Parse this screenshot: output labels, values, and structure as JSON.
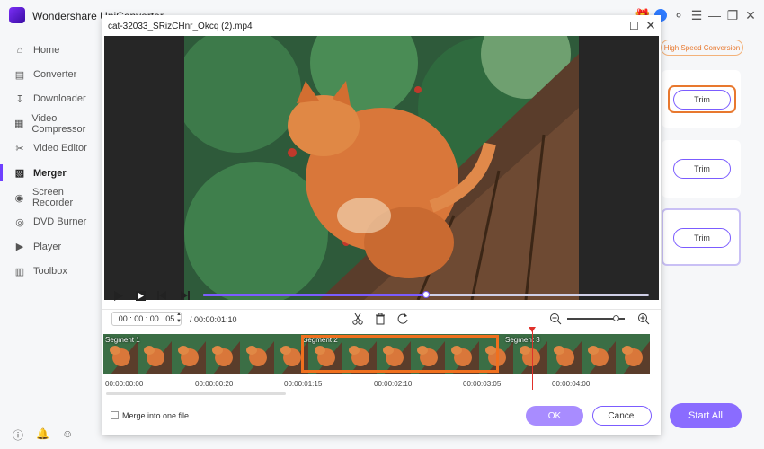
{
  "app": {
    "title": "Wondershare UniConverter"
  },
  "sidebar": {
    "items": [
      {
        "label": "Home",
        "icon": "home-icon"
      },
      {
        "label": "Converter",
        "icon": "converter-icon"
      },
      {
        "label": "Downloader",
        "icon": "downloader-icon"
      },
      {
        "label": "Video Compressor",
        "icon": "compressor-icon"
      },
      {
        "label": "Video Editor",
        "icon": "scissors-icon"
      },
      {
        "label": "Merger",
        "icon": "merger-icon",
        "active": true
      },
      {
        "label": "Screen Recorder",
        "icon": "recorder-icon"
      },
      {
        "label": "DVD Burner",
        "icon": "dvd-icon"
      },
      {
        "label": "Player",
        "icon": "player-icon"
      },
      {
        "label": "Toolbox",
        "icon": "toolbox-icon"
      }
    ]
  },
  "right_panel": {
    "high_speed_label": "High Speed Conversion",
    "trim_label": "Trim",
    "start_all_label": "Start All"
  },
  "dialog": {
    "title": "cat-32033_SRizCHnr_Okcq (2).mp4",
    "current_time": "00 : 00 : 00 . 05",
    "duration": "/ 00:00:01:10",
    "progress": 0.5,
    "zoom_level": 0.85,
    "segments": [
      "Segment 1",
      "Segment 2",
      "Segment 3"
    ],
    "ruler": [
      "00:00:00:00",
      "00:00:00:20",
      "00:00:01:15",
      "00:00:02:10",
      "00:00:03:05",
      "00:00:04:00"
    ],
    "merge_label": "Merge into one file",
    "ok_label": "OK",
    "cancel_label": "Cancel"
  },
  "colors": {
    "accent": "#7b5cff",
    "highlight": "#f0701e",
    "playhead": "#e0302a"
  }
}
